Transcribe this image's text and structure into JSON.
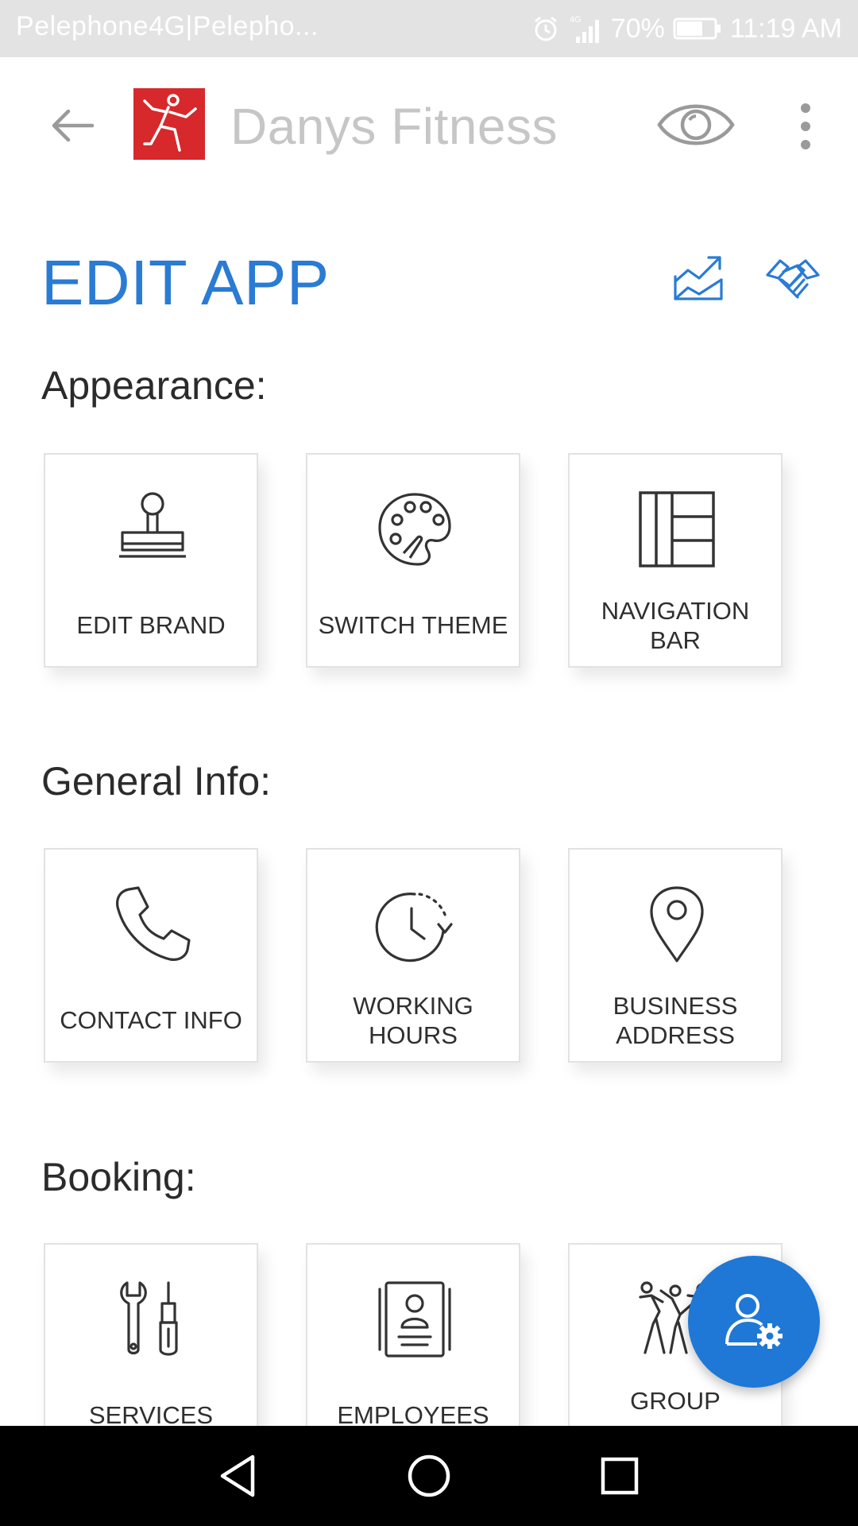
{
  "status_bar": {
    "carrier": "Pelephone4G|Pelepho...",
    "network": "4G",
    "battery": "70%",
    "battery_level": 0.7,
    "time": "11:19 AM",
    "icons": [
      "alarm-icon",
      "signal-icon",
      "battery-icon"
    ]
  },
  "app_bar": {
    "app_name": "Danys Fitness",
    "back_icon": "arrow-left-icon",
    "logo_icon": "fitness-figure-logo",
    "preview_icon": "eye-icon",
    "more_icon": "more-vertical-icon"
  },
  "page": {
    "title": "EDIT APP",
    "header_icons": [
      "stats-chart-icon",
      "handshake-icon"
    ]
  },
  "sections": [
    {
      "title": "Appearance:",
      "tiles": [
        {
          "label": "EDIT BRAND",
          "icon": "stamp-icon"
        },
        {
          "label": "SWITCH THEME",
          "icon": "palette-icon"
        },
        {
          "label": "NAVIGATION BAR",
          "icon": "layout-grid-icon"
        }
      ]
    },
    {
      "title": "General Info:",
      "tiles": [
        {
          "label": "CONTACT INFO",
          "icon": "phone-icon"
        },
        {
          "label": "WORKING HOURS",
          "icon": "clock-icon"
        },
        {
          "label": "BUSINESS ADDRESS",
          "icon": "map-pin-icon"
        }
      ]
    },
    {
      "title": "Booking:",
      "tiles": [
        {
          "label": "SERVICES",
          "icon": "tools-icon"
        },
        {
          "label": "EMPLOYEES",
          "icon": "id-card-icon"
        },
        {
          "label": "GROUP",
          "icon": "group-exercise-icon"
        }
      ]
    }
  ],
  "fab": {
    "icon": "user-settings-icon"
  },
  "nav_bar": {
    "icons": [
      "back-triangle-icon",
      "home-circle-icon",
      "recents-square-icon"
    ]
  },
  "colors": {
    "accent": "#2a7bd4",
    "fab": "#1f78d6",
    "logo": "#d7282c",
    "status_bar": "#e3e3e3",
    "nav_bar": "#000000"
  }
}
